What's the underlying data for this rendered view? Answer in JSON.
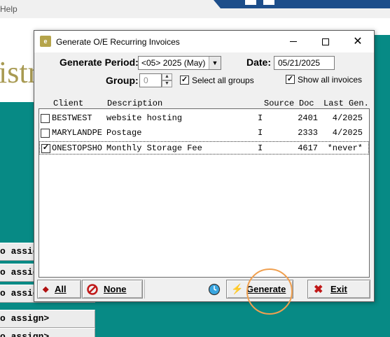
{
  "background": {
    "menu_help": "Help",
    "banner_text": "istr",
    "assign_items": [
      "o assign",
      "o assign",
      "o assign",
      "o assign>",
      "o assign>"
    ]
  },
  "dialog": {
    "title": "Generate O/E Recurring Invoices",
    "generate_period_label": "Generate Period:",
    "generate_period_value": "<05> 2025 (May)",
    "date_label": "Date:",
    "date_value": "05/21/2025",
    "group_label": "Group:",
    "group_value": "0",
    "select_all_groups_label": "Select all groups",
    "select_all_groups_checked": true,
    "show_all_invoices_label": "Show all invoices",
    "show_all_invoices_checked": true,
    "columns": {
      "client": "Client",
      "description": "Description",
      "source": "Source",
      "doc": "Doc",
      "last_gen": "Last Gen."
    },
    "rows": [
      {
        "checked": false,
        "client": "BESTWEST",
        "description": "website hosting",
        "source": "I",
        "doc": "2401",
        "last_gen": "4/2025"
      },
      {
        "checked": false,
        "client": "MARYLANDPE",
        "description": "Postage",
        "source": "I",
        "doc": "2333",
        "last_gen": "4/2025"
      },
      {
        "checked": true,
        "client": "ONESTOPSHO",
        "description": "Monthly Storage Fee",
        "source": "I",
        "doc": "4617",
        "last_gen": "*never*"
      }
    ],
    "buttons": {
      "all": "All",
      "none": "None",
      "generate": "Generate",
      "exit": "Exit"
    }
  },
  "colors": {
    "teal_background": "#078a85",
    "banner_text": "#a89a52",
    "highlight": "#f0a050"
  }
}
